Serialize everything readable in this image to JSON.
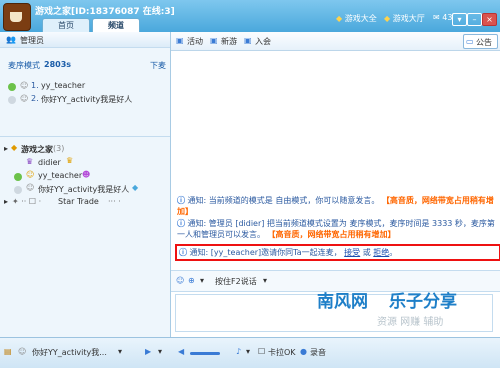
{
  "window": {
    "title": "游戏之家[ID:18376087 在线:3]"
  },
  "tabs": [
    {
      "label": "首页"
    },
    {
      "label": "频道"
    }
  ],
  "top_right": {
    "game_center": "游戏大全",
    "game_hall": "游戏大厅",
    "count": "43"
  },
  "left": {
    "admin_label": "管理员",
    "mode_label": "麦序模式",
    "mode_time": "2803s",
    "mode_next": "下麦",
    "queue": [
      {
        "num": "1.",
        "name": "yy_teacher"
      },
      {
        "num": "2.",
        "name": "你好YY_activity我是好人"
      }
    ],
    "channel_name": "游戏之家",
    "channel_count": "(3)",
    "members": [
      {
        "name": "didier"
      },
      {
        "name": "yy_teacher"
      },
      {
        "name": "你好YY_activity我是好人"
      }
    ],
    "subchannel": "Star Trade"
  },
  "right": {
    "toolbar": {
      "activity": "活动",
      "news": "新游",
      "enter": "入会",
      "announcement": "公告"
    },
    "notices": [
      {
        "prefix": "通知:",
        "text": "当前频道的模式是 自由模式，你可以随意发言。",
        "warn": "【高音质，网络带宽占用稍有增加】"
      },
      {
        "prefix": "通知:",
        "text": "管理员 [didier] 把当前频道模式设置为 麦序模式，麦序时间是 3333 秒，麦序第一人和管理员可以发言。",
        "warn": "【高音质，网络带宽占用稍有增加】"
      },
      {
        "prefix": "通知:",
        "text": "[yy_teacher]邀请你同Ta一起连麦，",
        "accept": "接受",
        "or": "或",
        "reject": "拒绝",
        "end": "。"
      }
    ],
    "ptt_label": "按住F2说话"
  },
  "bottom": {
    "user": "你好YY_activity我...",
    "karaoke": "卡拉OK",
    "record": "录音"
  },
  "watermark": {
    "brand_a": "南风网",
    "brand_b": "乐子分享",
    "tagline": "资源 网赚 辅助"
  }
}
